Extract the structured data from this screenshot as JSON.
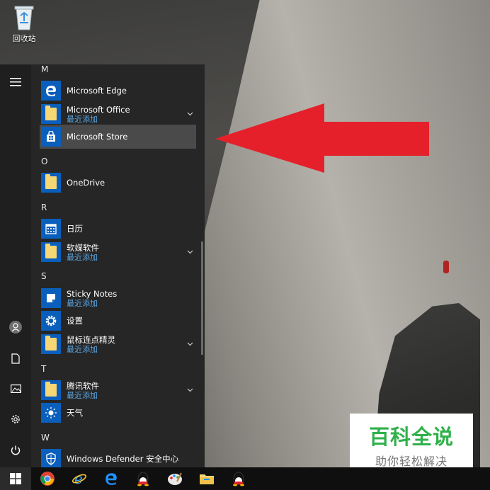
{
  "desktop": {
    "recycle_bin_label": "回收站"
  },
  "start_menu": {
    "sections": [
      {
        "letter": "M"
      },
      {
        "letter": "O"
      },
      {
        "letter": "R"
      },
      {
        "letter": "S"
      },
      {
        "letter": "T"
      },
      {
        "letter": "W"
      }
    ],
    "apps": [
      {
        "name": "Microsoft Edge",
        "sub": "",
        "icon": "edge-icon"
      },
      {
        "name": "Microsoft Office",
        "sub": "最近添加",
        "icon": "folder-icon"
      },
      {
        "name": "Microsoft Store",
        "sub": "",
        "icon": "store-icon",
        "selected": true
      },
      {
        "name": "OneDrive",
        "sub": "",
        "icon": "onedrive-icon"
      },
      {
        "name": "日历",
        "sub": "",
        "icon": "calendar-icon"
      },
      {
        "name": "软媒软件",
        "sub": "最近添加",
        "icon": "folder-icon"
      },
      {
        "name": "Sticky Notes",
        "sub": "最近添加",
        "icon": "sticky-notes-icon"
      },
      {
        "name": "设置",
        "sub": "",
        "icon": "gear-icon"
      },
      {
        "name": "鼠标连点精灵",
        "sub": "最近添加",
        "icon": "folder-icon"
      },
      {
        "name": "腾讯软件",
        "sub": "最近添加",
        "icon": "folder-icon"
      },
      {
        "name": "天气",
        "sub": "",
        "icon": "weather-icon"
      },
      {
        "name": "Windows Defender 安全中心",
        "sub": "",
        "icon": "shield-icon"
      }
    ]
  },
  "watermark": {
    "title": "百科全说",
    "subtitle": "助你轻松解决"
  },
  "taskbar": {
    "items": [
      "start-icon",
      "chrome-icon",
      "ie-icon",
      "edge-icon",
      "qq-icon",
      "paint-icon",
      "file-explorer-icon",
      "qq-icon"
    ]
  },
  "colors": {
    "accent": "#0a5fbd",
    "link_sub": "#5aa8e6",
    "arrow": "#e5202a",
    "watermark_green": "#2fb14a"
  }
}
